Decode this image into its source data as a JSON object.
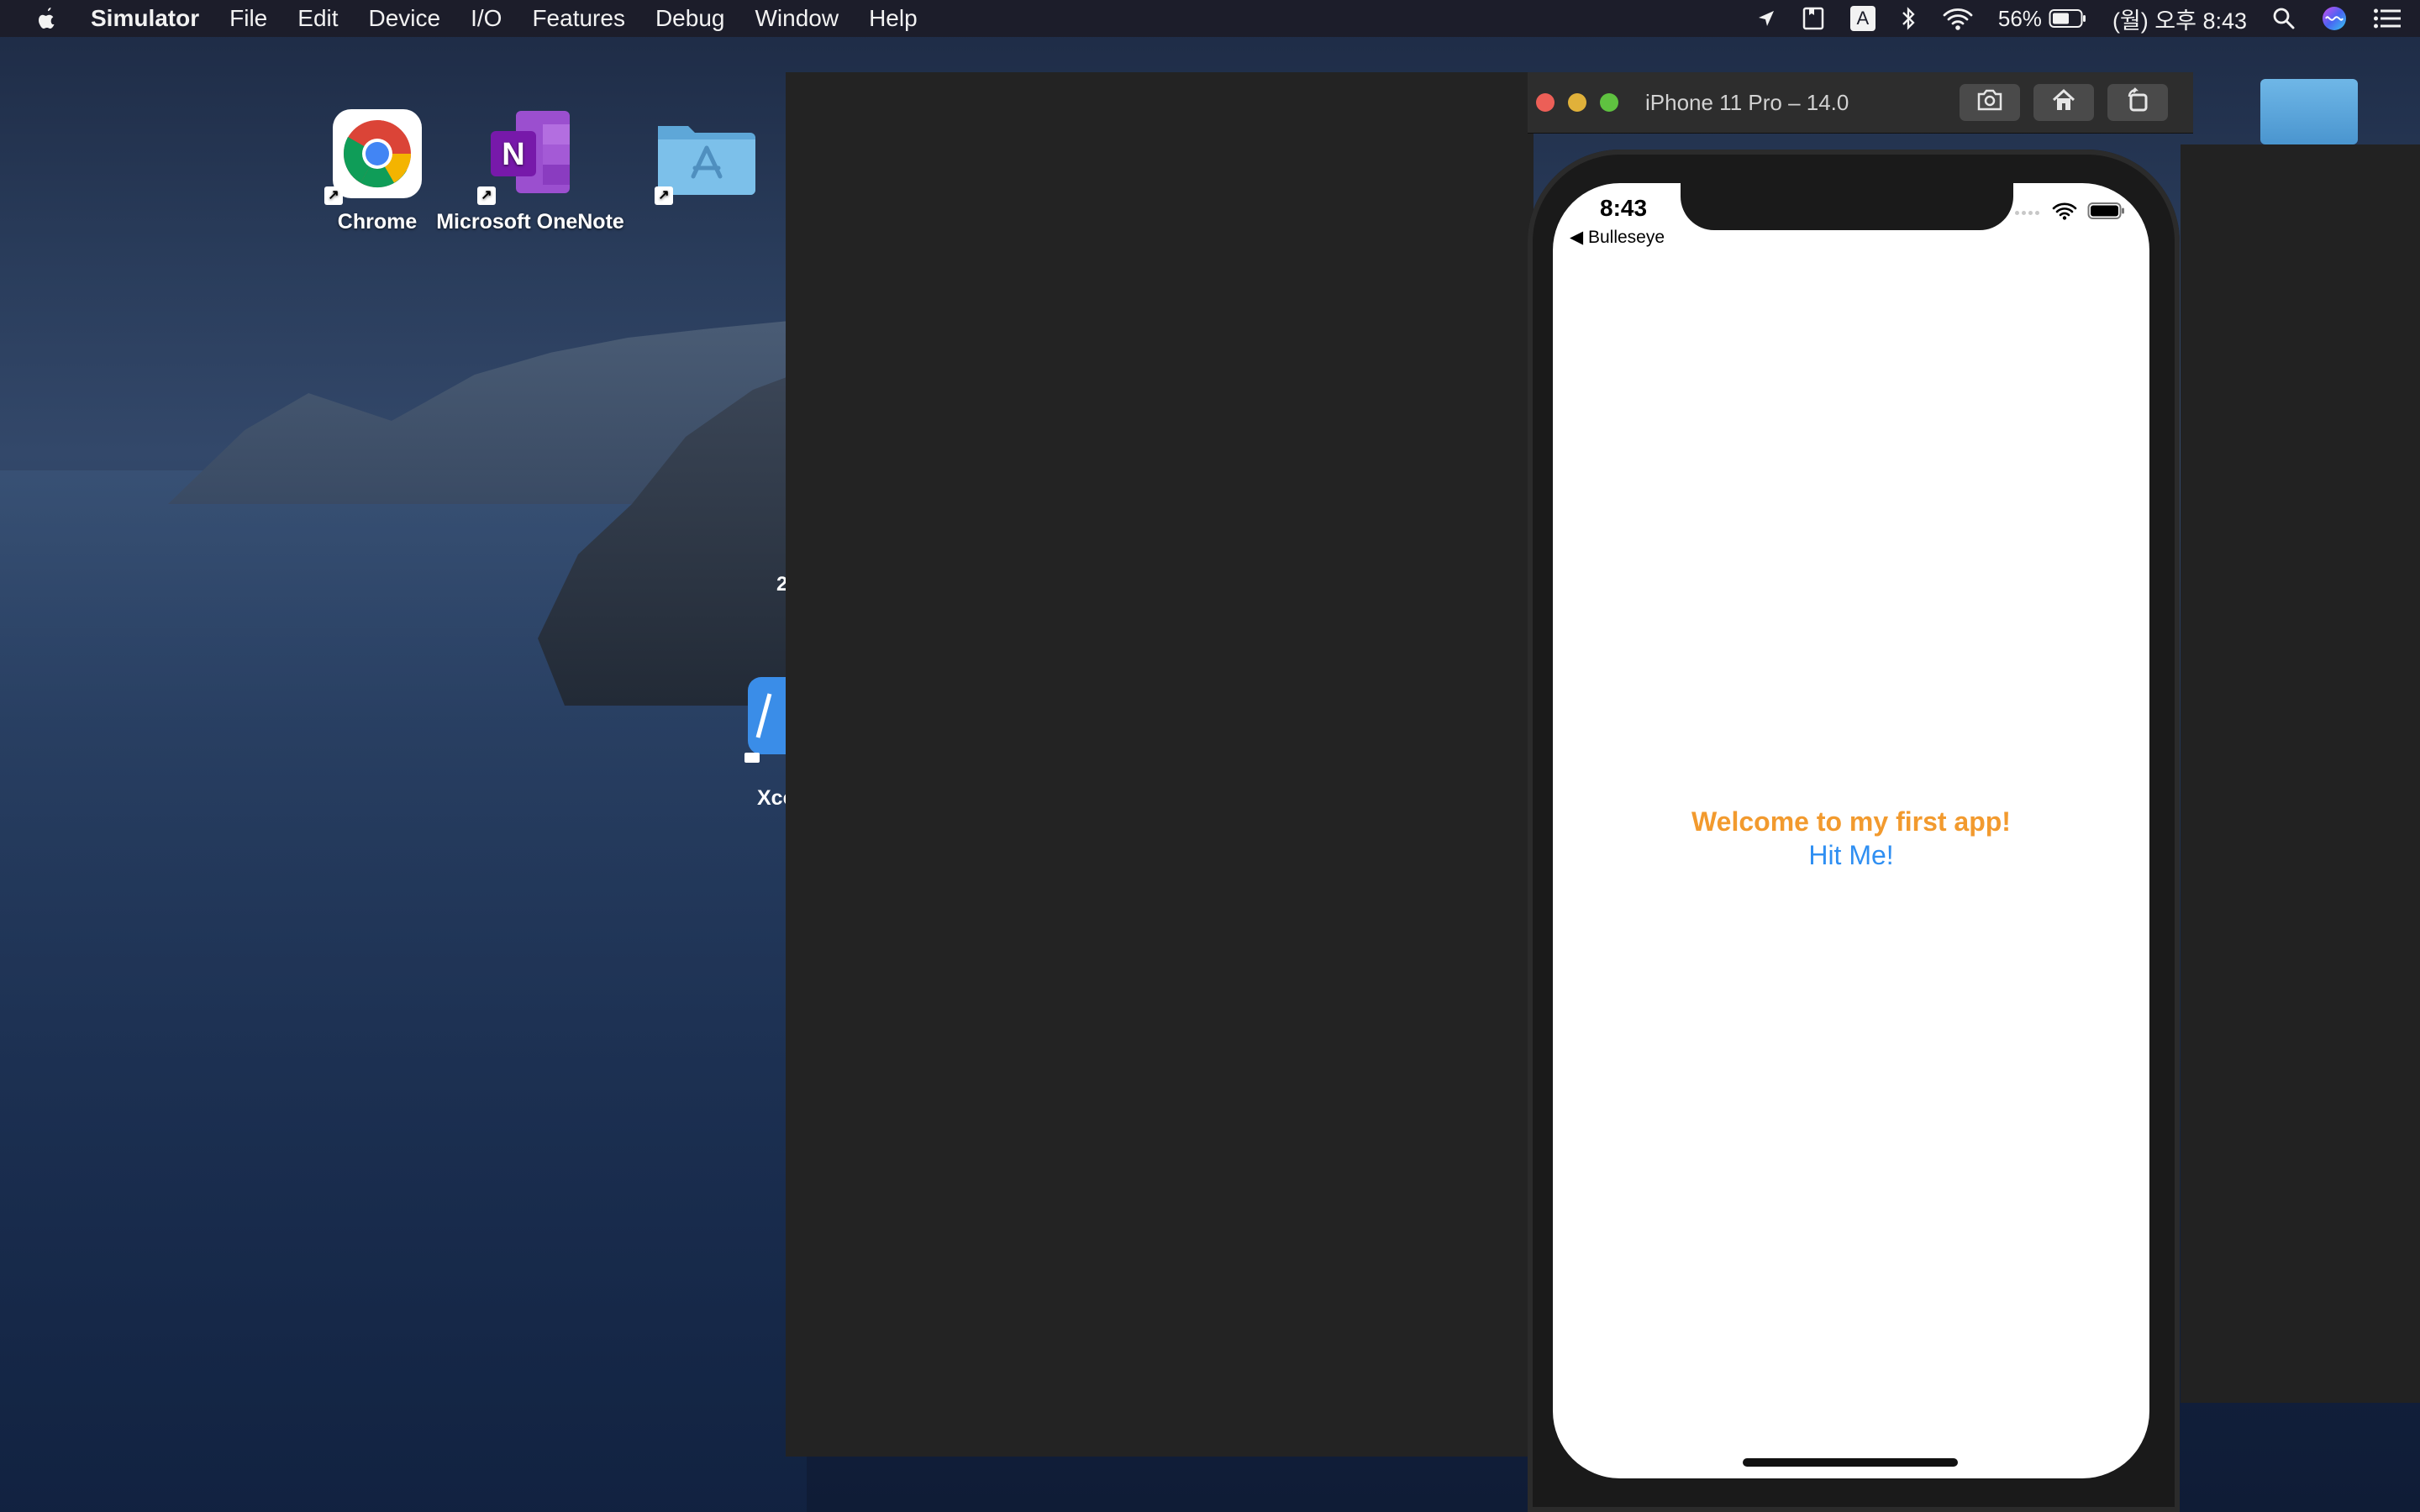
{
  "menubar": {
    "app_name": "Simulator",
    "items": [
      "File",
      "Edit",
      "Device",
      "I/O",
      "Features",
      "Debug",
      "Window",
      "Help"
    ],
    "battery_percent": "56%",
    "clock": "(월) 오후 8:43",
    "input_source": "A"
  },
  "desktop": {
    "icons": [
      {
        "label": "Chrome",
        "icon": "chrome-icon"
      },
      {
        "label": "Microsoft OneNote",
        "icon": "onenote-icon"
      },
      {
        "label": "",
        "icon": "app-store-folder-icon"
      }
    ],
    "partial_label_xcode": "Xcode",
    "partial_label_2": "2"
  },
  "simulator": {
    "window_title": "iPhone 11 Pro – 14.0",
    "toolbar": {
      "screenshot_icon": "camera-icon",
      "home_icon": "home-icon",
      "rotate_icon": "rotate-icon"
    },
    "phone": {
      "status_time": "8:43",
      "back_label": "◀ Bulleseye",
      "welcome_text": "Welcome to my first app!",
      "button_label": "Hit Me!"
    }
  },
  "colors": {
    "welcome": "#f29a2e",
    "button": "#2f8ff2",
    "menubar": "#1c1d2a",
    "window_dark": "#232323"
  }
}
